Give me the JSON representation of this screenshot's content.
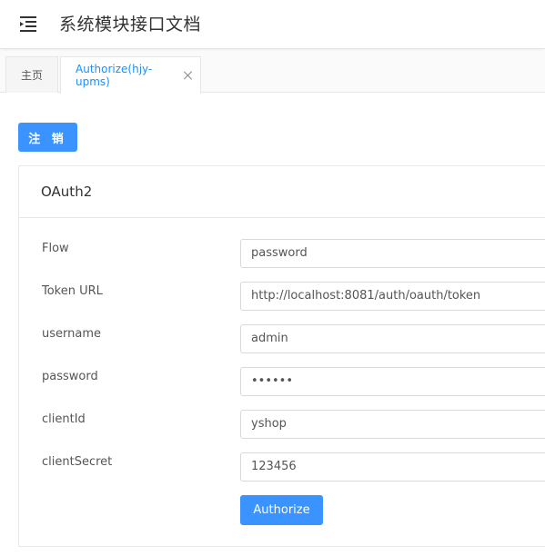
{
  "header": {
    "title": "系统模块接口文档",
    "menu_icon": "menu-fold-icon"
  },
  "tabs": [
    {
      "label": "主页",
      "active": false
    },
    {
      "label": "Authorize(hjy-upms)",
      "active": true,
      "closable": true
    }
  ],
  "logout_label": "注 销",
  "auth_card": {
    "title": "OAuth2",
    "fields": [
      {
        "label": "Flow",
        "value": "password"
      },
      {
        "label": "Token URL",
        "value": "http://localhost:8081/auth/oauth/token"
      },
      {
        "label": "username",
        "value": "admin"
      },
      {
        "label": "password",
        "value": "••••••"
      },
      {
        "label": "clientId",
        "value": "yshop"
      },
      {
        "label": "clientSecret",
        "value": "123456"
      }
    ],
    "authorize_label": "Authorize"
  },
  "colors": {
    "primary": "#3a93ff",
    "active_tab_text": "#1890ff",
    "border": "#e8e8e8"
  }
}
